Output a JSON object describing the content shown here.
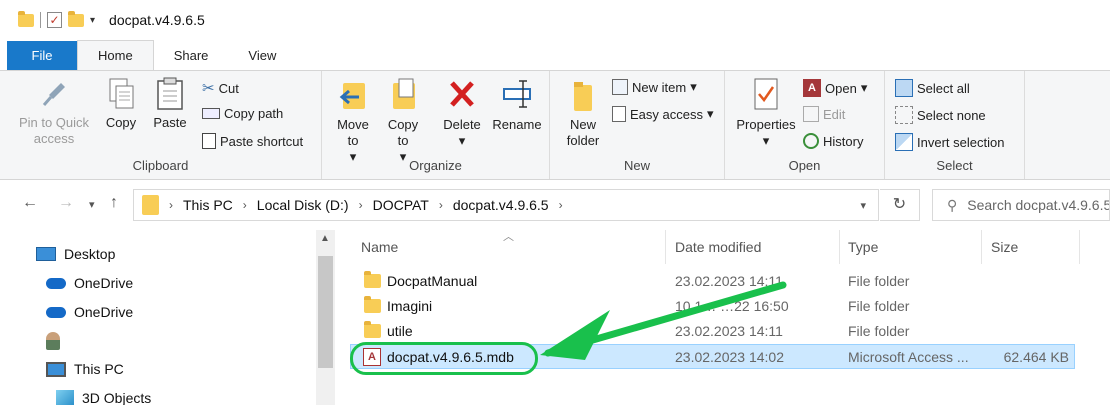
{
  "window": {
    "title": "docpat.v4.9.6.5"
  },
  "tabs": [
    "File",
    "Home",
    "Share",
    "View"
  ],
  "ribbon": {
    "clipboard": {
      "label": "Clipboard",
      "pin": "Pin to Quick access",
      "copy": "Copy",
      "paste": "Paste",
      "cut": "Cut",
      "copy_path": "Copy path",
      "paste_shortcut": "Paste shortcut"
    },
    "organize": {
      "label": "Organize",
      "move_to": "Move to",
      "copy_to": "Copy to",
      "delete": "Delete",
      "rename": "Rename"
    },
    "new": {
      "label": "New",
      "new_folder": "New folder",
      "new_item": "New item",
      "easy_access": "Easy access"
    },
    "open": {
      "label": "Open",
      "properties": "Properties",
      "open": "Open",
      "edit": "Edit",
      "history": "History"
    },
    "select": {
      "label": "Select",
      "select_all": "Select all",
      "select_none": "Select none",
      "invert_selection": "Invert selection"
    }
  },
  "address": {
    "breadcrumbs": [
      "This PC",
      "Local Disk (D:)",
      "DOCPAT",
      "docpat.v4.9.6.5"
    ],
    "search_placeholder": "Search docpat.v4.9.6.5"
  },
  "nav_pane": {
    "items": [
      "Desktop",
      "OneDrive",
      "OneDrive",
      "",
      "This PC",
      "3D Objects"
    ]
  },
  "columns": [
    "Name",
    "Date modified",
    "Type",
    "Size"
  ],
  "files": [
    {
      "name": "DocpatManual",
      "date": "23.02.2023 14:11",
      "type": "File folder",
      "size": ""
    },
    {
      "name": "Imagini",
      "date": "10.1… …22 16:50",
      "type": "File folder",
      "size": ""
    },
    {
      "name": "utile",
      "date": "23.02.2023 14:11",
      "type": "File folder",
      "size": ""
    },
    {
      "name": "docpat.v4.9.6.5.mdb",
      "date": "23.02.2023 14:02",
      "type": "Microsoft Access ...",
      "size": "62.464 KB"
    }
  ],
  "colors": {
    "accent": "#1979ca",
    "selection": "#cce8ff",
    "annotation": "#19c04c"
  }
}
